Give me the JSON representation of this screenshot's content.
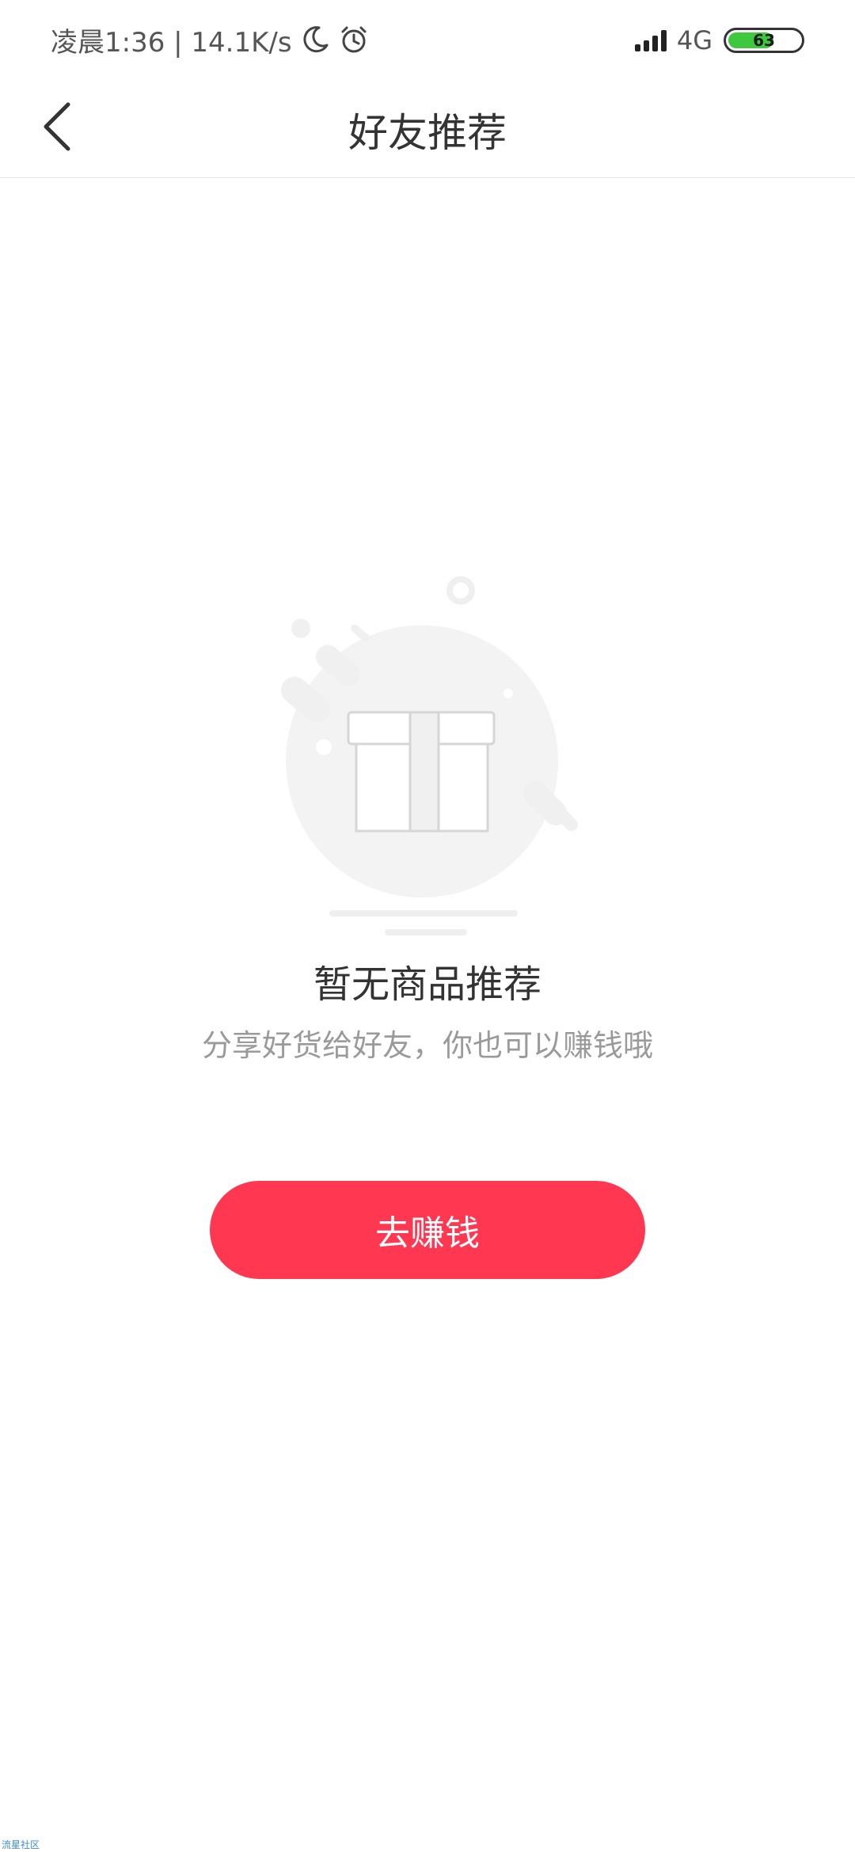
{
  "status_bar": {
    "time_and_speed": "凌晨1:36 | 14.1K/s",
    "network": "4G",
    "battery_level": "63",
    "battery_fraction": 0.63,
    "icons": [
      "moon-icon",
      "alarm-icon",
      "signal-icon",
      "battery-icon"
    ]
  },
  "header": {
    "title": "好友推荐",
    "back_icon": "chevron-left-icon"
  },
  "empty_state": {
    "illustration": "gift-box-icon",
    "title": "暂无商品推荐",
    "subtitle": "分享好货给好友，你也可以赚钱哦"
  },
  "actions": {
    "earn_label": "去赚钱"
  },
  "watermark": "流星社区",
  "colors": {
    "accent": "#ff3750",
    "title_text": "#333333",
    "subtitle_text": "#9a9a9a",
    "illustration_gray": "#f2f2f2",
    "battery_green": "#3dc83d"
  }
}
